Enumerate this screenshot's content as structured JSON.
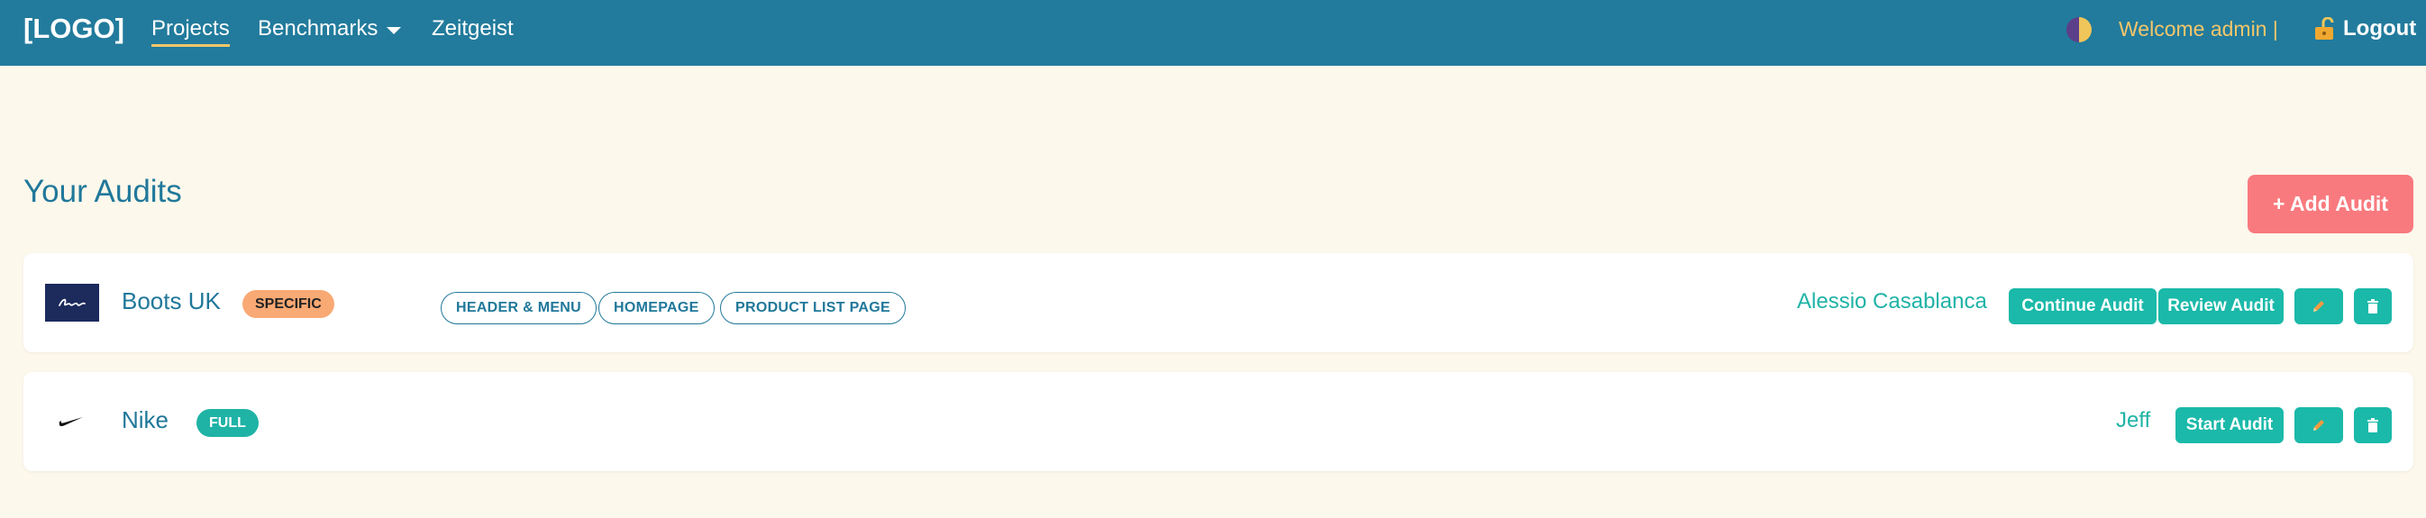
{
  "nav": {
    "logo": "[LOGO]",
    "links": [
      {
        "label": "Projects",
        "active": true
      },
      {
        "label": "Benchmarks",
        "has_dropdown": true
      },
      {
        "label": "Zeitgeist"
      }
    ],
    "welcome": "Welcome admin |",
    "logout": "Logout",
    "theme_toggle_icon": "half-moon-icon",
    "logout_icon": "unlock-icon"
  },
  "page": {
    "title": "Your Audits",
    "add_button": "+ Add Audit"
  },
  "audits": [
    {
      "brand": "Boots UK",
      "logo_icon": "boots-logo",
      "type": "SPECIFIC",
      "tags": [
        "HEADER & MENU",
        "HOMEPAGE",
        "PRODUCT LIST PAGE"
      ],
      "owner": "Alessio Casablanca",
      "actions": [
        "Continue Audit",
        "Review Audit"
      ]
    },
    {
      "brand": "Nike",
      "logo_icon": "nike-logo",
      "type": "FULL",
      "tags": [],
      "owner": "Jeff",
      "actions": [
        "Start Audit"
      ]
    }
  ],
  "colors": {
    "navbar": "#227b9c",
    "background": "#fdf8ec",
    "accent_teal": "#1bb9a9",
    "add_button": "#f87a7e",
    "welcome_text": "#f5c66a",
    "badge_specific": "#f9a974",
    "badge_full": "#1fb3a6"
  }
}
